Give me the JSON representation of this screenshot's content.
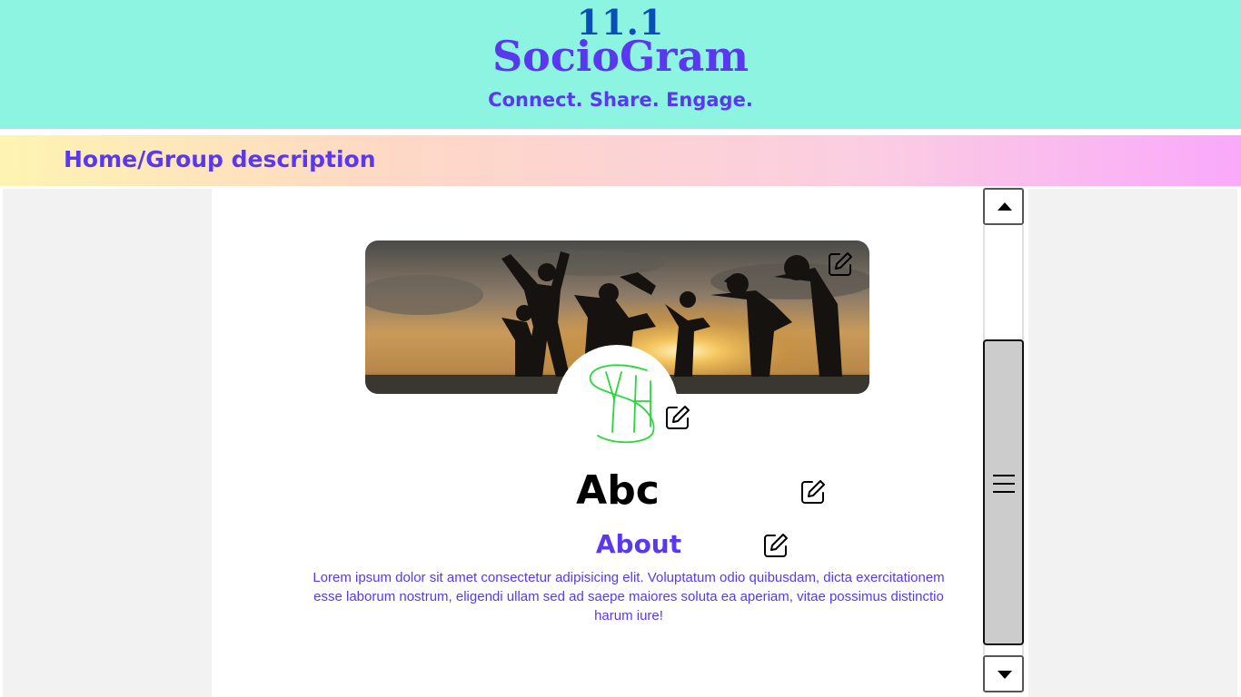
{
  "header": {
    "version": "11.1",
    "app_title": "SocioGram",
    "tagline": "Connect. Share. Engage.",
    "background_color": "#8ef4e2",
    "title_color": "#5a38f0",
    "version_color": "#0a4fb7"
  },
  "breadcrumb": {
    "text": "Home/Group description"
  },
  "group": {
    "cover_image": "group-silhouette-sunset-image",
    "avatar_logo": "yhs-logo",
    "name": "Abc",
    "about_title": "About",
    "about_text": "Lorem ipsum dolor sit amet consectetur adipisicing elit. Voluptatum odio quibusdam, dicta exercitationem esse laborum nostrum, eligendi ullam sed ad saepe maiores soluta ea aperiam, vitae possimus distinctio harum iure!"
  },
  "icons": {
    "edit": "edit-icon",
    "scroll_up": "triangle-up-icon",
    "scroll_down": "triangle-down-icon",
    "scroll_grip": "menu-lines-icon"
  },
  "colors": {
    "accent": "#5a38f0",
    "logo_green": "#2ad63a",
    "side_panels": "#f2f2f2"
  }
}
